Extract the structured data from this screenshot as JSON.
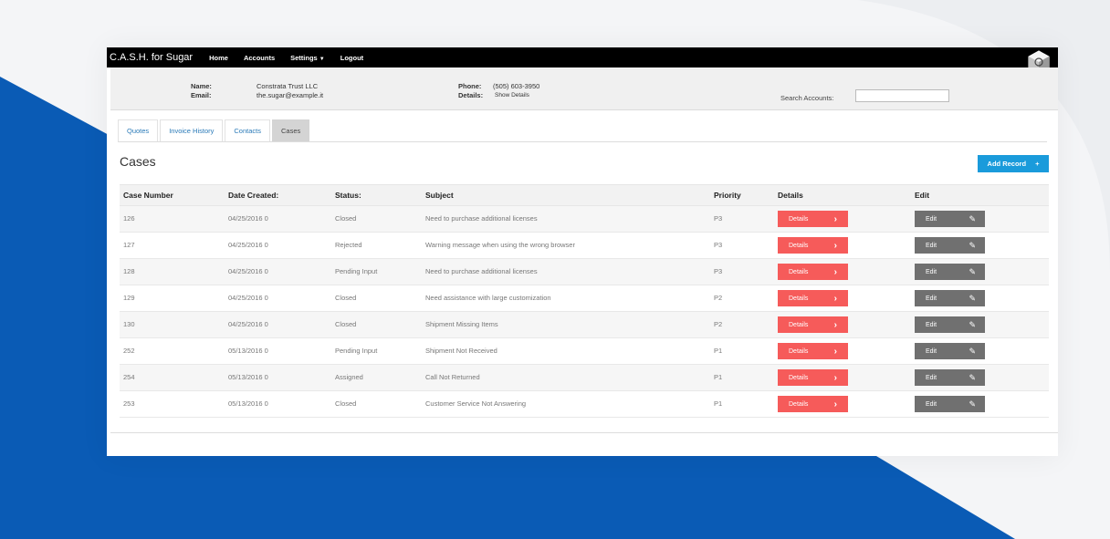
{
  "app": {
    "brand": "C.A.S.H. for Sugar"
  },
  "nav": {
    "home": "Home",
    "accounts": "Accounts",
    "settings": "Settings",
    "logout": "Logout"
  },
  "account": {
    "name_label": "Name:",
    "name": "Constrata Trust LLC",
    "email_label": "Email:",
    "email": "the.sugar@example.it",
    "phone_label": "Phone:",
    "phone": "(505) 603-3950",
    "details_label": "Details:",
    "details_link": "Show Details"
  },
  "search": {
    "label": "Search Accounts:",
    "value": "",
    "placeholder": ""
  },
  "tabs": [
    {
      "label": "Quotes",
      "active": false
    },
    {
      "label": "Invoice History",
      "active": false
    },
    {
      "label": "Contacts",
      "active": false
    },
    {
      "label": "Cases",
      "active": true
    }
  ],
  "section": {
    "title": "Cases",
    "add_label": "Add Record",
    "add_symbol": "+"
  },
  "table": {
    "columns": [
      "Case Number",
      "Date Created:",
      "Status:",
      "Subject",
      "Priority",
      "Details",
      "Edit"
    ],
    "details_label": "Details",
    "edit_label": "Edit",
    "rows": [
      {
        "case": "126",
        "date": "04/25/2016 0",
        "status": "Closed",
        "subject": "Need to purchase additional licenses",
        "priority": "P3"
      },
      {
        "case": "127",
        "date": "04/25/2016 0",
        "status": "Rejected",
        "subject": "Warning message when using the wrong browser",
        "priority": "P3"
      },
      {
        "case": "128",
        "date": "04/25/2016 0",
        "status": "Pending Input",
        "subject": "Need to purchase additional licenses",
        "priority": "P3"
      },
      {
        "case": "129",
        "date": "04/25/2016 0",
        "status": "Closed",
        "subject": "Need assistance with large customization",
        "priority": "P2"
      },
      {
        "case": "130",
        "date": "04/25/2016 0",
        "status": "Closed",
        "subject": "Shipment Missing Items",
        "priority": "P2"
      },
      {
        "case": "252",
        "date": "05/13/2016 0",
        "status": "Pending Input",
        "subject": "Shipment Not Received",
        "priority": "P1"
      },
      {
        "case": "254",
        "date": "05/13/2016 0",
        "status": "Assigned",
        "subject": "Call Not Returned",
        "priority": "P1"
      },
      {
        "case": "253",
        "date": "05/13/2016 0",
        "status": "Closed",
        "subject": "Customer Service Not Answering",
        "priority": "P1"
      }
    ]
  },
  "colors": {
    "background_blue": "#0a5bb5",
    "nav_bg": "#000000",
    "accent_blue": "#1a9bdb",
    "details_red": "#f65b5a",
    "edit_gray": "#707070"
  }
}
